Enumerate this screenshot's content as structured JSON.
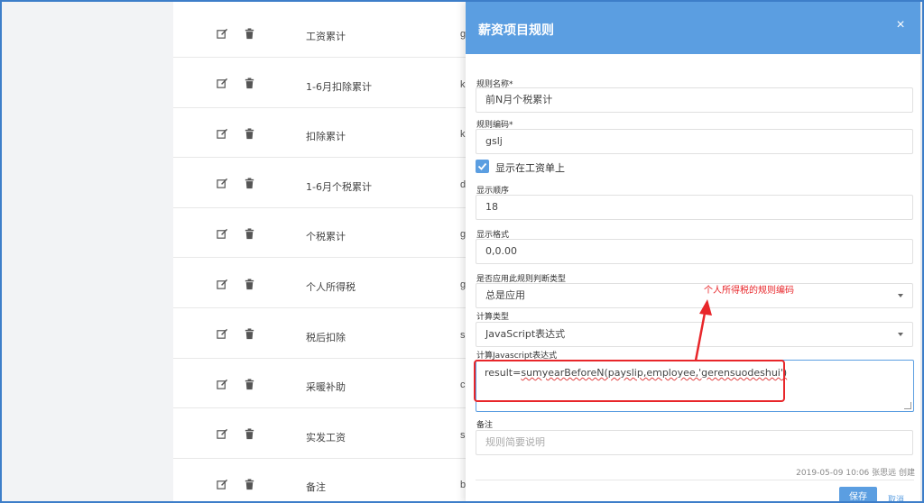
{
  "table": {
    "rows": [
      {
        "name": "工资累计",
        "code": "g"
      },
      {
        "name": "1-6月扣除累计",
        "code": "k"
      },
      {
        "name": "扣除累计",
        "code": "k"
      },
      {
        "name": "1-6月个税累计",
        "code": "d"
      },
      {
        "name": "个税累计",
        "code": "g"
      },
      {
        "name": "个人所得税",
        "code": "g"
      },
      {
        "name": "税后扣除",
        "code": "s"
      },
      {
        "name": "采暖补助",
        "code": "c"
      },
      {
        "name": "实发工资",
        "code": "s"
      },
      {
        "name": "备注",
        "code": "b"
      }
    ]
  },
  "modal": {
    "title": "薪资项目规则",
    "close_glyph": "×",
    "rule_name": {
      "label": "规则名称*",
      "value": "前N月个税累计"
    },
    "rule_code": {
      "label": "规则编码*",
      "value": "gslj"
    },
    "show_on_payslip": {
      "label": "显示在工资单上",
      "checked": true
    },
    "display_order": {
      "label": "显示顺序",
      "value": "18"
    },
    "display_format": {
      "label": "显示格式",
      "value": "0,0.00"
    },
    "apply_type": {
      "label": "是否应用此规则判断类型",
      "value": "总是应用"
    },
    "calc_type": {
      "label": "计算类型",
      "value": "JavaScript表达式"
    },
    "js_expression": {
      "label": "计算Javascript表达式",
      "prefix": "result=",
      "value_spell": "sumyearBeforeN(payslip,employee,'gerensuodeshui')"
    },
    "remark": {
      "label": "备注",
      "placeholder": "规则简要说明"
    },
    "meta": "2019-05-09 10:06 张思远 创建",
    "save_label": "保存",
    "cancel_label": "取消"
  },
  "annotation": {
    "text": "个人所得税的规则编码",
    "color": "#e8262a"
  },
  "colors": {
    "header": "#5b9ee1",
    "accent": "#5b9ee1",
    "frame": "#3d7ec9"
  }
}
